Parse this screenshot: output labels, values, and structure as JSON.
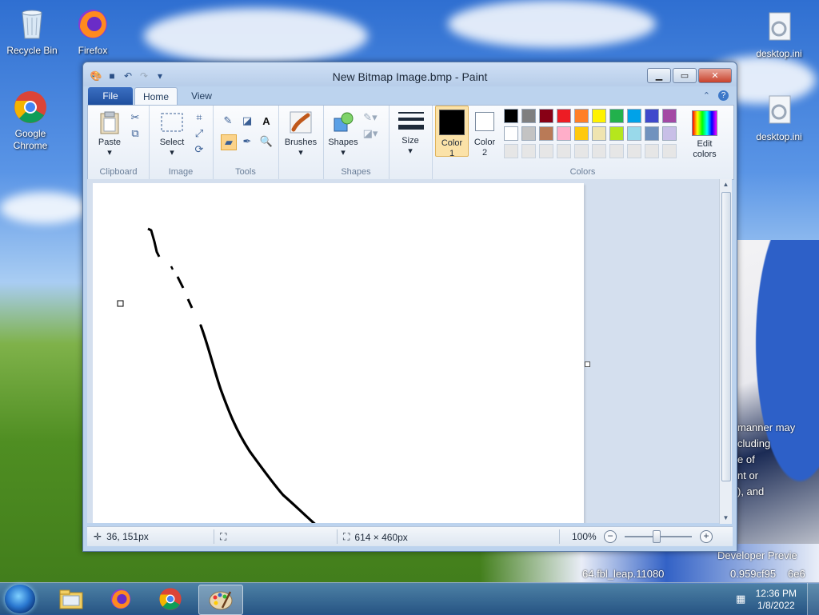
{
  "desktop": {
    "icons": [
      {
        "label": "Recycle Bin",
        "icon": "recycle-bin-icon"
      },
      {
        "label": "Firefox",
        "icon": "firefox-icon"
      },
      {
        "label": "Google Chrome",
        "icon": "chrome-icon"
      },
      {
        "label": "desktop.ini",
        "icon": "settings-file-icon"
      },
      {
        "label": "desktop.ini",
        "icon": "settings-file-icon"
      }
    ],
    "watermark": [
      "manner may",
      "cluding",
      "e of",
      "nt or",
      "), and",
      "Developer Previe",
      "64.fbl_leap.11080",
      "0.959cf95",
      "6e6"
    ]
  },
  "window": {
    "title": "New Bitmap Image.bmp - Paint",
    "tabs": {
      "file": "File",
      "home": "Home",
      "view": "View"
    }
  },
  "ribbon": {
    "clipboard": {
      "label": "Clipboard",
      "paste": "Paste"
    },
    "image": {
      "label": "Image",
      "select": "Select"
    },
    "tools": {
      "label": "Tools"
    },
    "brushes": {
      "label": "Brushes"
    },
    "shapes": {
      "label": "Shapes",
      "button": "Shapes"
    },
    "size": {
      "label": "Size"
    },
    "colors": {
      "label": "Colors",
      "color1_line1": "Color",
      "color1_line2": "1",
      "color2_line1": "Color",
      "color2_line2": "2",
      "edit_line1": "Edit",
      "edit_line2": "colors",
      "color1_value": "#000000",
      "color2_value": "#ffffff",
      "palette_row1": [
        "#000000",
        "#7f7f7f",
        "#880015",
        "#ed1c24",
        "#ff7f27",
        "#fff200",
        "#22b14c",
        "#00a2e8",
        "#3f48cc",
        "#a349a4"
      ],
      "palette_row2": [
        "#ffffff",
        "#c3c3c3",
        "#b97a57",
        "#ffaec9",
        "#ffc90e",
        "#efe4b0",
        "#b5e61d",
        "#99d9ea",
        "#7092be",
        "#c8bfe7"
      ],
      "palette_row3": [
        "#e6e6e6",
        "#e6e6e6",
        "#e6e6e6",
        "#e6e6e6",
        "#e6e6e6",
        "#e6e6e6",
        "#e6e6e6",
        "#e6e6e6",
        "#e6e6e6",
        "#e6e6e6"
      ]
    }
  },
  "status": {
    "cursor_pos": "36, 151px",
    "canvas_size": "614 × 460px",
    "zoom": "100%"
  },
  "taskbar": {
    "time": "12:36 PM",
    "date": "1/8/2022"
  }
}
